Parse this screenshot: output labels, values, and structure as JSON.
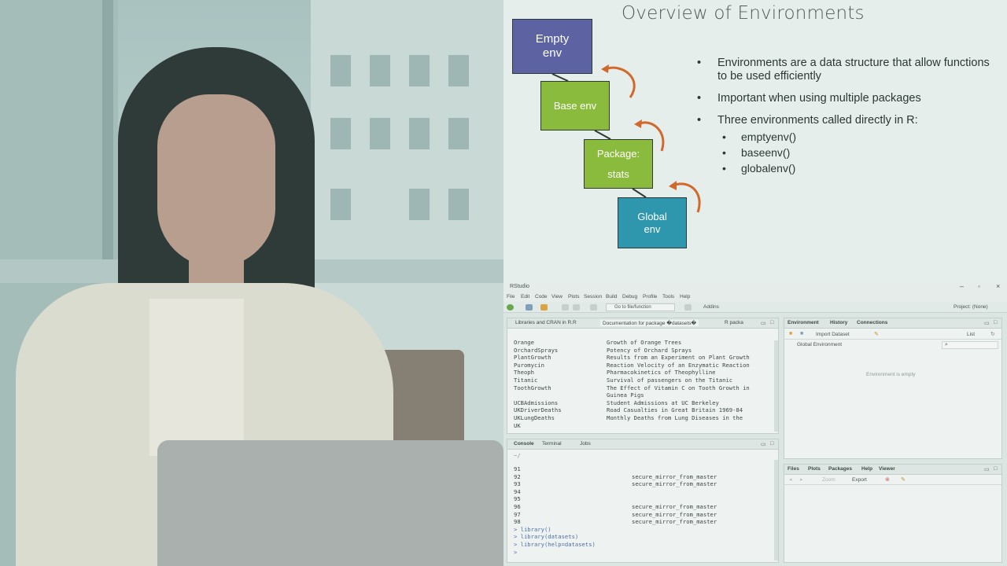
{
  "slide": {
    "title": "Overview of Environments",
    "envs": [
      {
        "label_line1": "Empty",
        "label_line2": "env",
        "color": "#5c62a2"
      },
      {
        "label_line1": "Base env",
        "label_line2": "",
        "color": "#8bbb3d"
      },
      {
        "label_line1": "Package:",
        "label_line2": "stats",
        "color": "#8bbb3d"
      },
      {
        "label_line1": "Global",
        "label_line2": "env",
        "color": "#2f97ad"
      }
    ],
    "arrow_color": "#d2692c",
    "bullets": [
      "Environments are a data structure that allow functions to be used efficiently",
      "Important when using multiple packages",
      "Three environments called directly in R:"
    ],
    "sub_bullets": [
      "emptyenv()",
      "baseenv()",
      "globalenv()"
    ]
  },
  "rstudio": {
    "window_title": "RStudio",
    "menu": [
      "File",
      "Edit",
      "Code",
      "View",
      "Plots",
      "Session",
      "Build",
      "Debug",
      "Profile",
      "Tools",
      "Help"
    ],
    "go_to_placeholder": "Go to file/function",
    "addins_label": "Addins",
    "project_label": "Project: (None)",
    "source_tabs": [
      "Libraries and CRAN in R.R",
      "Documentation for package �datasets�",
      "R packa"
    ],
    "datasets": [
      {
        "name": "Orange",
        "desc": "Growth of Orange Trees"
      },
      {
        "name": "OrchardSprays",
        "desc": "Potency of Orchard Sprays"
      },
      {
        "name": "PlantGrowth",
        "desc": "Results from an Experiment on Plant Growth"
      },
      {
        "name": "Puromycin",
        "desc": "Reaction Velocity of an Enzymatic Reaction"
      },
      {
        "name": "Theoph",
        "desc": "Pharmacokinetics of Theophylline"
      },
      {
        "name": "Titanic",
        "desc": "Survival of passengers on the Titanic"
      },
      {
        "name": "ToothGrowth",
        "desc": "The Effect of Vitamin C on Tooth Growth in"
      },
      {
        "name": "",
        "desc": "Guinea Pigs"
      },
      {
        "name": "UCBAdmissions",
        "desc": "Student Admissions at UC Berkeley"
      },
      {
        "name": "UKDriverDeaths",
        "desc": "Road Casualties in Great Britain 1969-84"
      },
      {
        "name": "UKLungDeaths",
        "desc": "Monthly Deaths from Lung Diseases in the"
      },
      {
        "name": "UK",
        "desc": ""
      }
    ],
    "console_tabs": [
      "Console",
      "Terminal",
      "Jobs"
    ],
    "console_path": "~/",
    "console_lines": [
      {
        "num": "91",
        "text": ""
      },
      {
        "num": "92",
        "text": "secure_mirror_from_master"
      },
      {
        "num": "93",
        "text": "secure_mirror_from_master"
      },
      {
        "num": "94",
        "text": ""
      },
      {
        "num": "95",
        "text": ""
      },
      {
        "num": "96",
        "text": "secure_mirror_from_master"
      },
      {
        "num": "97",
        "text": "secure_mirror_from_master"
      },
      {
        "num": "98",
        "text": "secure_mirror_from_master"
      }
    ],
    "console_cmds": [
      "> library()",
      "> library(datasets)",
      "> library(help=datasets)",
      "> "
    ],
    "env_tabs": [
      "Environment",
      "History",
      "Connections"
    ],
    "import_dataset_label": "Import Dataset",
    "list_label": "List",
    "global_env_label": "Global Environment",
    "env_empty_text": "Environment is empty",
    "files_tabs": [
      "Files",
      "Plots",
      "Packages",
      "Help",
      "Viewer"
    ],
    "zoom_label": "Zoom",
    "export_label": "Export"
  }
}
